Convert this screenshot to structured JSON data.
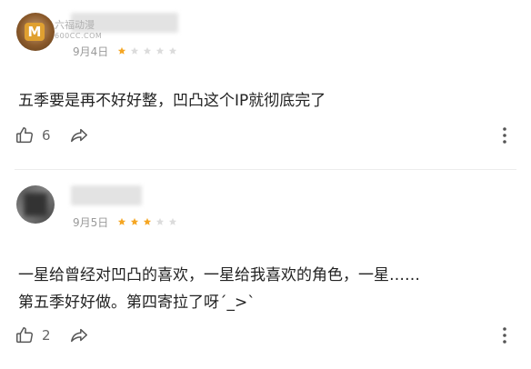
{
  "comments": [
    {
      "watermark_line1": "六福动漫",
      "watermark_line2": "600CC.COM",
      "date": "9月4日",
      "rating": 1,
      "rating_max": 5,
      "text": "五季要是再不好好整，凹凸这个IP就彻底完了",
      "likes": "6"
    },
    {
      "date": "9月5日",
      "rating": 3,
      "rating_max": 5,
      "text": "一星给曾经对凹凸的喜欢，一星给我喜欢的角色，一星……\n第五季好好做。第四寄拉了呀´_>`",
      "likes": "2"
    }
  ],
  "colors": {
    "star_on": "#f5a623",
    "star_off": "#dcdcdc",
    "icon": "#555555"
  }
}
